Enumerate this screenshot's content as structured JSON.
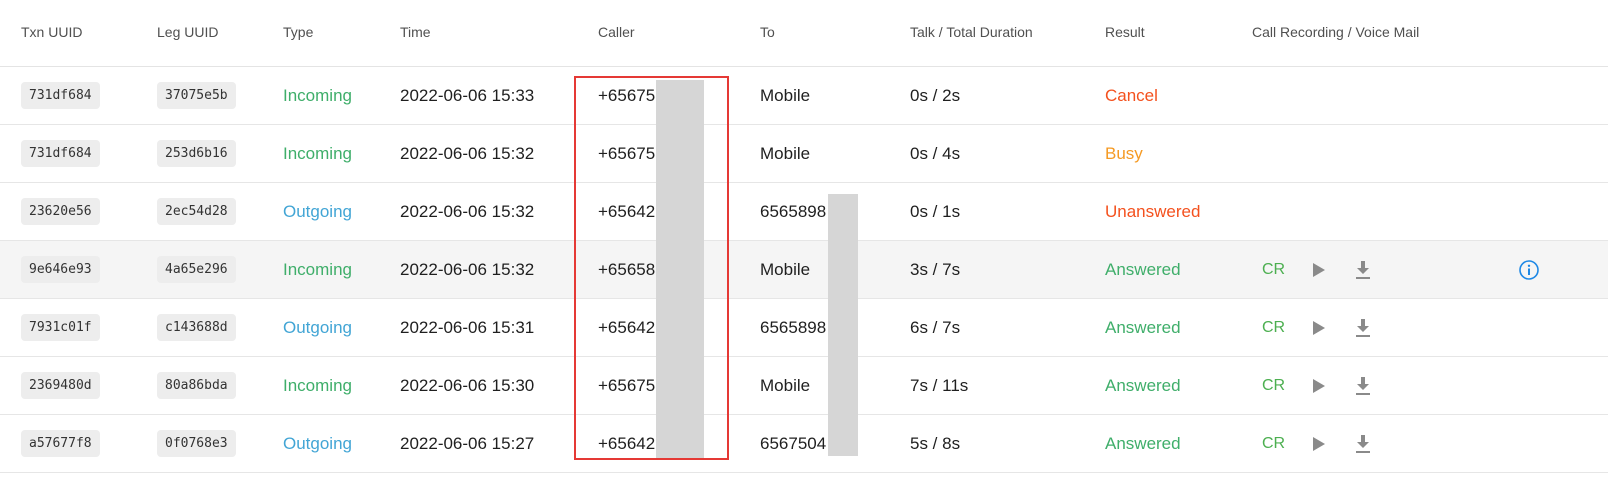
{
  "columns": {
    "txn": "Txn UUID",
    "leg": "Leg UUID",
    "type": "Type",
    "time": "Time",
    "caller": "Caller",
    "to": "To",
    "duration": "Talk / Total Duration",
    "result": "Result",
    "recording": "Call Recording / Voice Mail"
  },
  "colors": {
    "incoming": "#3fae6a",
    "outgoing": "#42a5d5",
    "cancel": "#f4511e",
    "busy": "#f59a23",
    "unanswered": "#f4511e",
    "answered": "#3fae6a",
    "accent_blue": "#1e88e5",
    "highlight_box": "#e53935"
  },
  "rows": [
    {
      "txn": "731df684",
      "leg": "37075e5b",
      "type": "Incoming",
      "time": "2022-06-06 15:33",
      "caller": "+65675(",
      "to": "Mobile",
      "duration": "0s / 2s",
      "result": "Cancel",
      "recording": null
    },
    {
      "txn": "731df684",
      "leg": "253d6b16",
      "type": "Incoming",
      "time": "2022-06-06 15:32",
      "caller": "+65675(",
      "to": "Mobile",
      "duration": "0s / 4s",
      "result": "Busy",
      "recording": null
    },
    {
      "txn": "23620e56",
      "leg": "2ec54d28",
      "type": "Outgoing",
      "time": "2022-06-06 15:32",
      "caller": "+656428",
      "to": "6565898",
      "duration": "0s / 1s",
      "result": "Unanswered",
      "recording": null
    },
    {
      "txn": "9e646e93",
      "leg": "4a65e296",
      "type": "Incoming",
      "time": "2022-06-06 15:32",
      "caller": "+656589",
      "to": "Mobile",
      "duration": "3s / 7s",
      "result": "Answered",
      "recording": {
        "label": "CR",
        "icons": [
          "play-icon",
          "download-icon"
        ]
      },
      "info_icon": "info-icon"
    },
    {
      "txn": "7931c01f",
      "leg": "c143688d",
      "type": "Outgoing",
      "time": "2022-06-06 15:31",
      "caller": "+656428",
      "to": "6565898",
      "duration": "6s / 7s",
      "result": "Answered",
      "recording": {
        "label": "CR",
        "icons": [
          "play-icon",
          "download-icon"
        ]
      }
    },
    {
      "txn": "2369480d",
      "leg": "80a86bda",
      "type": "Incoming",
      "time": "2022-06-06 15:30",
      "caller": "+65675(",
      "to": "Mobile",
      "duration": "7s / 11s",
      "result": "Answered",
      "recording": {
        "label": "CR",
        "icons": [
          "play-icon",
          "download-icon"
        ]
      }
    },
    {
      "txn": "a57677f8",
      "leg": "0f0768e3",
      "type": "Outgoing",
      "time": "2022-06-06 15:27",
      "caller": "+656428",
      "to": "6567504",
      "duration": "5s / 8s",
      "result": "Answered",
      "recording": {
        "label": "CR",
        "icons": [
          "play-icon",
          "download-icon"
        ]
      }
    }
  ]
}
